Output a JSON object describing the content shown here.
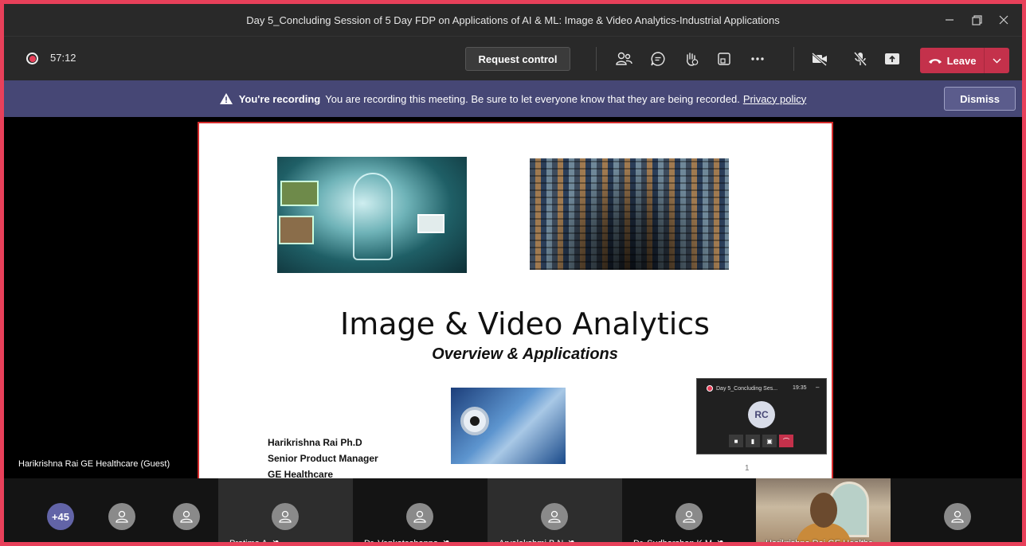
{
  "window": {
    "title": "Day 5_Concluding Session of 5 Day FDP on Applications of AI & ML: Image & Video Analytics-Industrial Applications"
  },
  "toolbar": {
    "timer": "57:12",
    "request_control": "Request control",
    "leave": "Leave"
  },
  "banner": {
    "bold": "You're recording",
    "message": "You are recording this meeting. Be sure to let everyone know that they are being recorded.",
    "link": "Privacy policy",
    "dismiss": "Dismiss"
  },
  "stage": {
    "presenter": "Harikrishna Rai GE Healthcare (Guest)"
  },
  "slide": {
    "title": "Image & Video Analytics",
    "subtitle": "Overview & Applications",
    "author_name": "Harikrishna Rai Ph.D",
    "author_role": "Senior Product Manager",
    "author_org": "GE Healthcare",
    "page": "1"
  },
  "mini_window": {
    "title": "Day 5_Concluding Ses...",
    "time": "19:35",
    "initials": "RC"
  },
  "participants": {
    "more_count": "+45",
    "names": [
      "Pratima A",
      "Dr. Venkateshappa",
      "Aryalekshmi B N",
      "Dr. Sudharshan K M",
      "Harikrishna Rai GE Healthc..."
    ]
  },
  "colors": {
    "accent_red": "#c4314b",
    "banner_bg": "#464775",
    "more_badge": "#6264a7",
    "frame_border": "#e8405a"
  }
}
